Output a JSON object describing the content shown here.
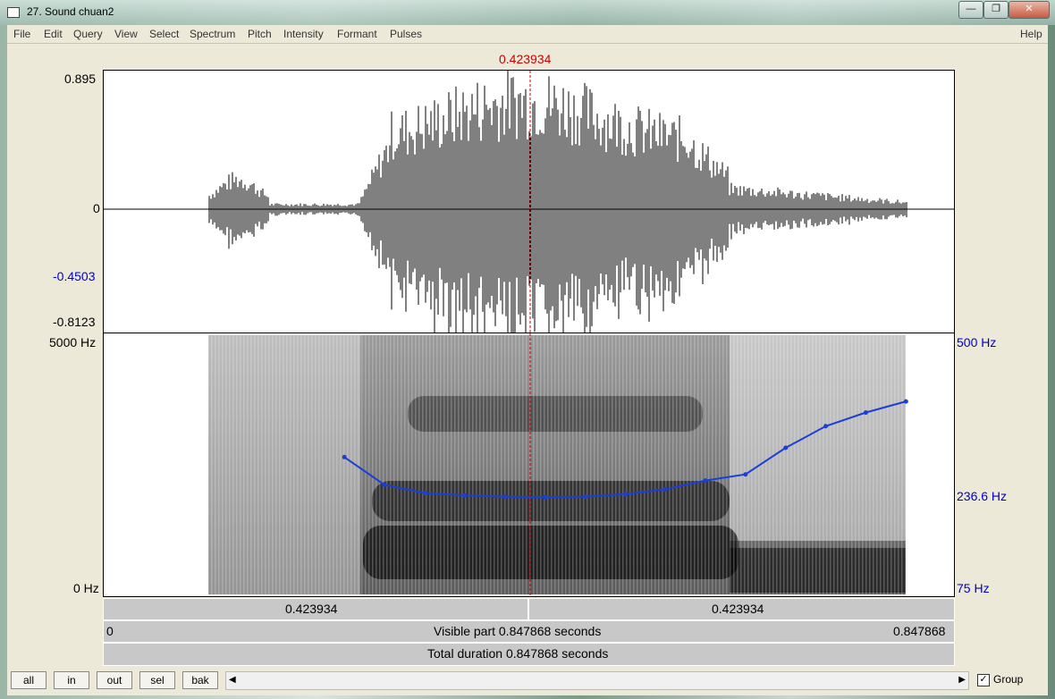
{
  "window": {
    "title": "27. Sound chuan2",
    "controls": {
      "minimize": "—",
      "maximize": "❐",
      "close": "✕"
    }
  },
  "menu": {
    "items": [
      "File",
      "Edit",
      "Query",
      "View",
      "Select",
      "Spectrum",
      "Pitch",
      "Intensity",
      "Formant",
      "Pulses"
    ],
    "help": "Help"
  },
  "cursor": {
    "time_label": "0.423934"
  },
  "waveform": {
    "y_max": "0.895",
    "y_zero": "0",
    "y_marker": "-0.4503",
    "y_min": "-0.8123"
  },
  "spectrogram": {
    "freq_top": "5000 Hz",
    "freq_bottom": "0 Hz",
    "pitch_top": "500 Hz",
    "pitch_mid": "236.6 Hz",
    "pitch_bottom": "75 Hz",
    "pitch_color": "#1a3fd6"
  },
  "chart_data": {
    "type": "line",
    "title": "",
    "xlabel": "",
    "ylabel": "",
    "xlim": [
      0,
      0.847868
    ],
    "ylim": [
      75,
      500
    ],
    "series": [
      {
        "x": [
          0.24,
          0.28,
          0.32,
          0.36,
          0.4,
          0.44,
          0.48,
          0.52,
          0.56,
          0.6,
          0.64,
          0.68,
          0.72,
          0.76,
          0.8
        ],
        "values": [
          300,
          255,
          242,
          238,
          236,
          235,
          236,
          240,
          248,
          262,
          272,
          315,
          350,
          372,
          390
        ]
      }
    ]
  },
  "timebars": {
    "left_cursor": "0.423934",
    "right_cursor": "0.423934",
    "start": "0",
    "visible": "Visible part 0.847868 seconds",
    "end": "0.847868",
    "total": "Total duration 0.847868 seconds"
  },
  "buttons": {
    "all": "all",
    "in": "in",
    "out": "out",
    "sel": "sel",
    "bak": "bak"
  },
  "scroll": {
    "left": "◀",
    "right": "▶"
  },
  "group": {
    "label": "Group",
    "checked": "✓"
  }
}
